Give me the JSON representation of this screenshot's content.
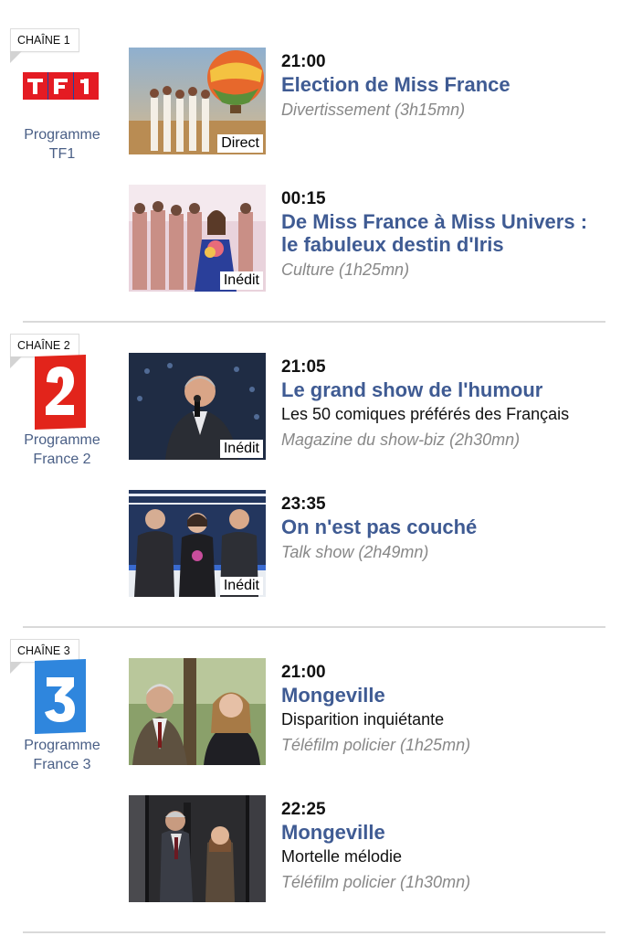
{
  "channels": [
    {
      "tag": "CHAÎNE 1",
      "logo_icon": "tf1-logo-icon",
      "program_label_line1": "Programme",
      "program_label_line2": "TF1",
      "shows": [
        {
          "time": "21:00",
          "title": "Election de Miss France",
          "genre": "Divertissement (3h15mn)",
          "badge": "Direct"
        },
        {
          "time": "00:15",
          "title_line1": "De Miss France à Miss Univers :",
          "title_line2": "le fabuleux destin d'Iris",
          "genre": "Culture (1h25mn)",
          "badge": "Inédit"
        }
      ]
    },
    {
      "tag": "CHAÎNE 2",
      "logo_icon": "france2-logo-icon",
      "program_label_line1": "Programme",
      "program_label_line2": "France 2",
      "shows": [
        {
          "time": "21:05",
          "title": "Le grand show de l'humour",
          "subtitle": "Les 50 comiques préférés des Français",
          "genre": "Magazine du show-biz (2h30mn)",
          "badge": "Inédit"
        },
        {
          "time": "23:35",
          "title": "On n'est pas couché",
          "genre": "Talk show (2h49mn)",
          "badge": "Inédit"
        }
      ]
    },
    {
      "tag": "CHAÎNE 3",
      "logo_icon": "france3-logo-icon",
      "program_label_line1": "Programme",
      "program_label_line2": "France 3",
      "shows": [
        {
          "time": "21:00",
          "title": "Mongeville",
          "subtitle": "Disparition inquiétante",
          "genre": "Téléfilm policier (1h25mn)"
        },
        {
          "time": "22:25",
          "title": "Mongeville",
          "subtitle": "Mortelle mélodie",
          "genre": "Téléfilm policier (1h30mn)"
        }
      ]
    }
  ],
  "colors": {
    "title_blue": "#3f5b93",
    "program_link": "#4a5f86",
    "genre_gray": "#888888",
    "tf1_red": "#e41b23",
    "tf1_blue": "#1a44a6",
    "france2_red": "#e2241b",
    "france3_blue": "#2f86dd"
  }
}
